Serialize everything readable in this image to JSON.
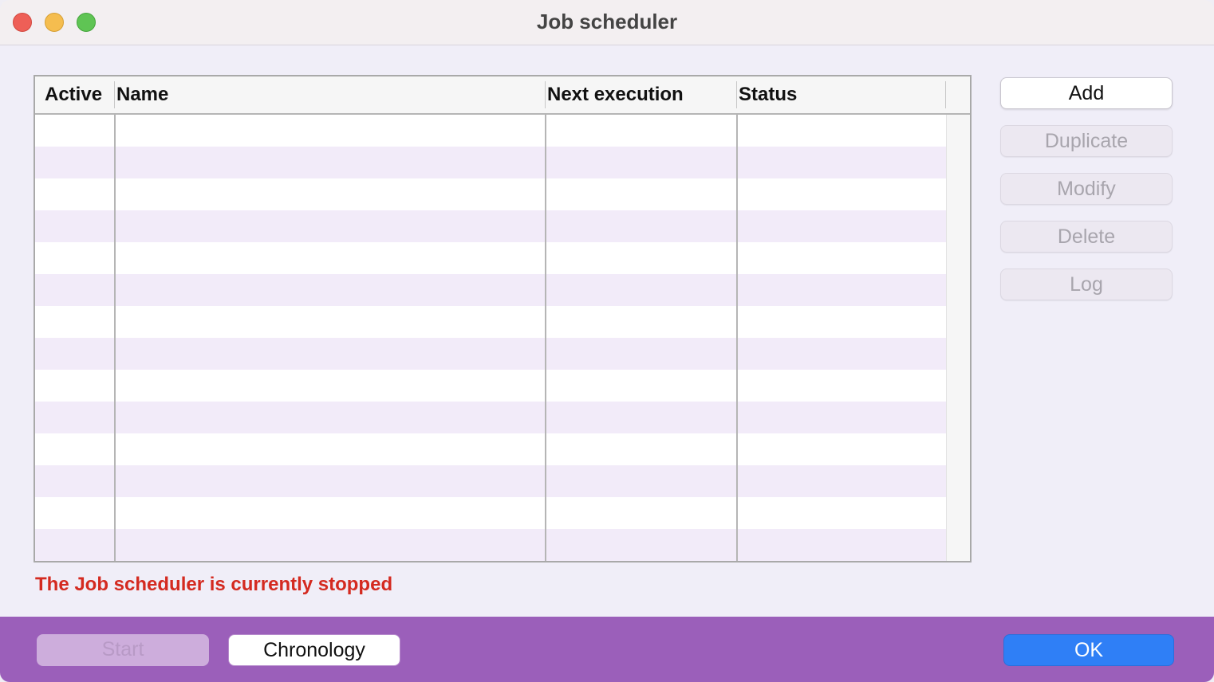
{
  "window": {
    "title": "Job scheduler"
  },
  "table": {
    "columns": [
      "Active",
      "Name",
      "Next execution",
      "Status"
    ],
    "rows": []
  },
  "side_buttons": {
    "add": "Add",
    "duplicate": "Duplicate",
    "modify": "Modify",
    "delete": "Delete",
    "log": "Log"
  },
  "status_message": "The Job scheduler is currently stopped",
  "bottom_buttons": {
    "start": "Start",
    "chronology": "Chronology",
    "ok": "OK"
  },
  "colors": {
    "status_text": "#d42a20",
    "bottom_bar": "#9b5fba",
    "ok_button": "#2f7ff6",
    "row_stripe": "#f2ebf9"
  }
}
